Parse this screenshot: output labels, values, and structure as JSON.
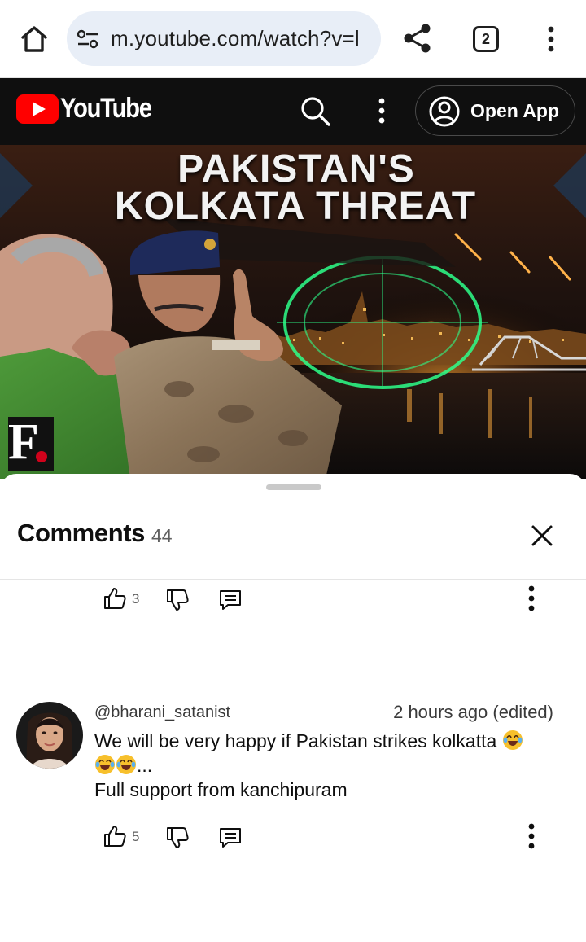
{
  "browser": {
    "url": "m.youtube.com/watch?v=l",
    "tab_count": "2",
    "icons": [
      "home-icon",
      "tune-icon",
      "share-icon",
      "more-vert-icon"
    ]
  },
  "youtube_header": {
    "wordmark": "YouTube",
    "open_app_label": "Open App",
    "brand_color": "#ff0000",
    "icons": [
      "youtube-logo-icon",
      "search-icon",
      "more-vert-icon",
      "account-circle-icon"
    ]
  },
  "video_thumbnail": {
    "title_line1": "PAKISTAN'S",
    "title_line2": "KOLKATA THREAT",
    "channel_mark": "F"
  },
  "comments_panel": {
    "title": "Comments",
    "count": "44",
    "previous_comment": {
      "like_count": "3"
    },
    "comment": {
      "author": "@bharani_satanist",
      "time": "2 hours ago (edited)",
      "line1": "We will be very happy if Pakistan strikes kolkatta",
      "line2_suffix": "...",
      "line3": "Full support from kanchipuram",
      "like_count": "5"
    }
  }
}
